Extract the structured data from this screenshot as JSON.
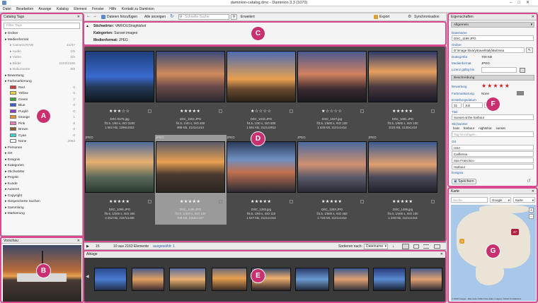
{
  "window": {
    "title": "daminion-catalog.dmc - Daminion 3.3 (1070)",
    "controls": [
      "–",
      "□",
      "✕"
    ]
  },
  "menu": [
    "Datei",
    "Bearbeiten",
    "Anzeige",
    "Katalog",
    "Element",
    "Fenster",
    "Hilfe",
    "Kontakt zu Daminion"
  ],
  "toolbar": {
    "add_files": "Dateien hinzufügen",
    "show_all": "Alle anzeigen",
    "search_placeholder": "Schnelle Suche",
    "advanced": "Erweitert",
    "export": "Export",
    "sync": "Synchronisation"
  },
  "left_panel": {
    "title": "Catalog Tags",
    "filter_placeholder": "Filter Tags",
    "items": [
      {
        "label": "Ordner",
        "type": "group"
      },
      {
        "label": "Medienformat",
        "type": "group"
      },
      {
        "label": "Camera RAW",
        "count": "41/47",
        "type": "sub"
      },
      {
        "label": "Audio",
        "count": "1/5",
        "type": "sub"
      },
      {
        "label": "Video",
        "count": "1/5",
        "type": "sub"
      },
      {
        "label": "Bilder",
        "count": "2103/2106",
        "type": "sub"
      },
      {
        "label": "Dokumente",
        "count": "8/8",
        "type": "sub"
      },
      {
        "label": "Bewertung",
        "type": "group"
      },
      {
        "label": "Farbmarkierung",
        "type": "group"
      }
    ],
    "colors": [
      {
        "label": "Red",
        "count": "0",
        "color": "#d63b3b"
      },
      {
        "label": "Yellow",
        "count": "0",
        "color": "#e8d23a"
      },
      {
        "label": "Green",
        "count": "1",
        "color": "#3aa63a"
      },
      {
        "label": "Blue",
        "count": "0",
        "color": "#3a5fd6"
      },
      {
        "label": "Purple",
        "count": "0",
        "color": "#8a3ad6"
      },
      {
        "label": "Orange",
        "count": "1",
        "color": "#e8902a"
      },
      {
        "label": "Pink",
        "count": "8",
        "color": "#e87fb0"
      },
      {
        "label": "Brown",
        "count": "0",
        "color": "#8a5a2a"
      },
      {
        "label": "Cyan",
        "count": "0",
        "color": "#3ad6d6"
      },
      {
        "label": "None",
        "count": "2063",
        "color": "#ffffff"
      }
    ],
    "groups2": [
      "Personen",
      "Ort",
      "Ereignis",
      "Kategorien",
      "Stichwörter",
      "Projekt",
      "Kunde",
      "Autoren",
      "Copyright",
      "Gespeicherte Suchen",
      "Sammlung",
      "Markierung"
    ]
  },
  "preview": {
    "title": "Vorschau"
  },
  "filter_bar": {
    "rows": [
      {
        "key": "Stichwörter:",
        "value": "VARIOUS\\nightshot"
      },
      {
        "key": "Kategorien:",
        "value": "Sunset images"
      },
      {
        "key": "Medienformat:",
        "value": "JPEG"
      }
    ]
  },
  "grid": {
    "format_label": "JPEG",
    "row1": [
      {
        "file": "DSC-0275.jpg",
        "exif": "f/3.5, 1/60 s, ISO 3200",
        "size": "1 561 KB, 2296x1522",
        "rating": 3
      },
      {
        "file": "DSC_1002.JPG",
        "exif": "f/4.5, 1/40 s, ISO 400",
        "size": "908 KB, 2121x1414",
        "rating": 5
      },
      {
        "file": "DSC_1018.JPG",
        "exif": "f/4.5, 1/30 s, ISO 800",
        "size": "1 591 KB, 2121x2912",
        "rating": 1
      },
      {
        "file": "DSC_1027.jpg",
        "exif": "f/3.5, 1/500 s, ISO 100",
        "size": "1 635 KB, 2121x1414",
        "rating": 1
      },
      {
        "file": "DSC_1081.JPG",
        "exif": "f/3.5, 1/500 s, ISO 100",
        "size": "1023 KB, 2130x1410",
        "rating": 5
      }
    ],
    "row2": [
      {
        "file": "DSC_1096.JPG",
        "exif": "f/5.6, 1/200 s, ISO 400",
        "size": "2 252 KB, 2157x1438",
        "rating": 5
      },
      {
        "file": "DSC_1189.JPG",
        "exif": "f/4.0, 1/400 s, ISO 100",
        "size": "708 KB, 2156x1437",
        "rating": 5
      },
      {
        "file": "DSC_1282.jpg",
        "exif": "f/5.5, 1/50 s, ISO 110",
        "size": "1 647 KB, 2121x1414",
        "rating": 5
      },
      {
        "file": "DSC_1283.JPG",
        "exif": "f/3.5, 1/500 s, ISO 450",
        "size": "1 745 KB, 2121x1414",
        "rating": 5
      },
      {
        "file": "DSC_1495.jpg",
        "exif": "f/4.0, 1/400 s, ISO 100",
        "size": "1 235 KB, 2121x1414",
        "rating": 5
      }
    ]
  },
  "statusbar": {
    "count": "15",
    "elements": "10 aus 2163 Elemente",
    "selected": "ausgewählt: 1",
    "sort_label": "Sortieren nach:",
    "sort_value": "Dateiname"
  },
  "tray": {
    "title": "Ablage"
  },
  "properties": {
    "title": "Eigenschaften",
    "dropdown": "Allgemein",
    "filename_label": "Dateiname",
    "filename": "DSC_1189.JPG",
    "folder_label": "Ordner",
    "folder": "D:\\Image library\\travel\\Italy\\Bolzena",
    "filesize_label": "Dateigröße",
    "filesize": "708 KB",
    "format_label": "Medienformat",
    "format": "JPEG",
    "license_label": "Lizenz gültig bis",
    "desc_section": "Beschreibung",
    "rating_label": "Bewertung",
    "color_label": "Farbmarkierung",
    "color_value": "None",
    "created_label": "Erstellungsdatum",
    "created_day": "31",
    "created_month": "Juli",
    "created_year": "20",
    "title_label": "Titel",
    "title_value": "Sunset at the harbour",
    "keywords_label": "Stichwörter",
    "keywords": [
      "boat",
      "harbour",
      "nightshot",
      "sunset"
    ],
    "add_tag": "Tag hinzufügen...",
    "place_label": "Ort",
    "places": [
      "USA",
      "California",
      "San Francisco",
      "Harbour"
    ],
    "event_label": "Ereignis",
    "save": "Speichern"
  },
  "map": {
    "title": "Karte",
    "search_placeholder": "Suche",
    "provider": "Google",
    "mode": "Karte",
    "pin_count": "47",
    "pin2": "3",
    "credit": "© 2015 Google - Map data ©2014 Tele Atlas, Imagery ©2014 TerraMetrics"
  },
  "callouts": [
    "A",
    "B",
    "C",
    "D",
    "E",
    "F",
    "G"
  ]
}
